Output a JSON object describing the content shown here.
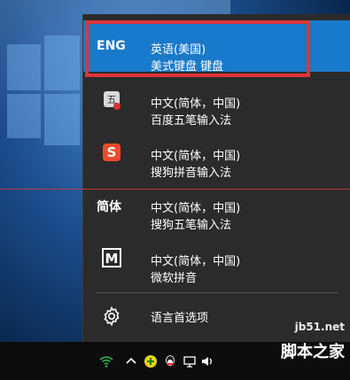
{
  "languages": [
    {
      "code": "ENG",
      "name": "英语(美国)",
      "layout": "美式键盘 键盘",
      "icon": "eng-text",
      "active": true
    },
    {
      "code": "",
      "name": "中文(简体，中国)",
      "layout": "百度五笔输入法",
      "icon": "baidu-wubi-icon",
      "active": false
    },
    {
      "code": "",
      "name": "中文(简体，中国)",
      "layout": "搜狗拼音输入法",
      "icon": "sogou-icon",
      "active": false
    },
    {
      "code": "简体",
      "name": "中文(简体，中国)",
      "layout": "搜狗五笔输入法",
      "icon": "jianti-text",
      "active": false
    },
    {
      "code": "",
      "name": "中文(简体，中国)",
      "layout": "微软拼音",
      "icon": "microsoft-pinyin-icon",
      "active": false
    }
  ],
  "preferences_label": "语言首选项",
  "watermark": {
    "site": "jb51.net",
    "text": "脚本之家"
  },
  "colors": {
    "accent": "#1979ca",
    "highlight_border": "#e0333c",
    "panel_bg": "#2b2b2b"
  }
}
